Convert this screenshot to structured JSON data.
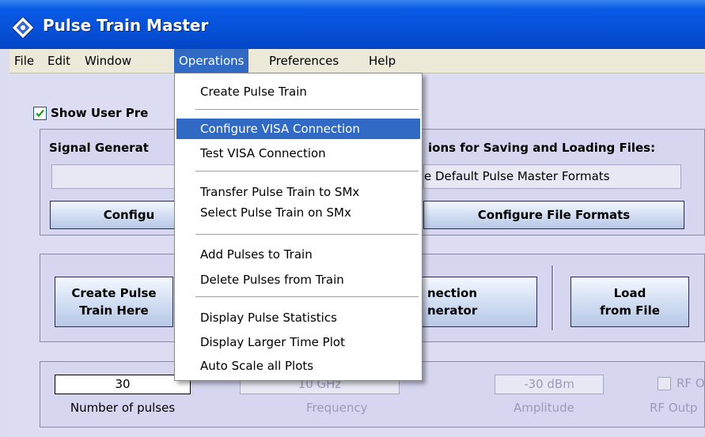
{
  "window": {
    "title": "Pulse Train Master"
  },
  "menubar": {
    "items": [
      "File",
      "Edit",
      "Window",
      "Operations",
      "Preferences",
      "Help"
    ],
    "active": "Operations"
  },
  "operations_menu": {
    "items": [
      "Create Pulse Train",
      "Configure VISA Connection",
      "Test VISA Connection",
      "Transfer Pulse Train to SMx",
      "Select Pulse Train on SMx",
      "Add Pulses to Train",
      "Delete Pulses from Train",
      "Display Pulse Statistics",
      "Display Larger Time Plot",
      "Auto Scale all Plots"
    ],
    "highlighted": "Configure VISA Connection"
  },
  "top_panel": {
    "show_user_prefs_label": "Show User Pre",
    "show_user_prefs_checked": true,
    "signal_generator_label": "Signal Generat",
    "file_options_label": "ions for Saving and Loading Files:",
    "file_formats_value": "e Default Pulse Master Formats",
    "configure_button": "Configu",
    "configure_file_formats_button": "Configure File Formats"
  },
  "middle_panel": {
    "create_pulse_button_line1": "Create Pulse",
    "create_pulse_button_line2": "Train Here",
    "connection_button_line1": "nection",
    "connection_button_line2": "nerator",
    "load_button_line1": "Load",
    "load_button_line2": "from File"
  },
  "bottom_panel": {
    "number_of_pulses_value": "30",
    "number_of_pulses_label": "Number of pulses",
    "frequency_value": "10 GHz",
    "frequency_label": "Frequency",
    "amplitude_value": "-30 dBm",
    "amplitude_label": "Amplitude",
    "rf_on_label": "RF Of",
    "rf_output_label": "RF Outp"
  }
}
